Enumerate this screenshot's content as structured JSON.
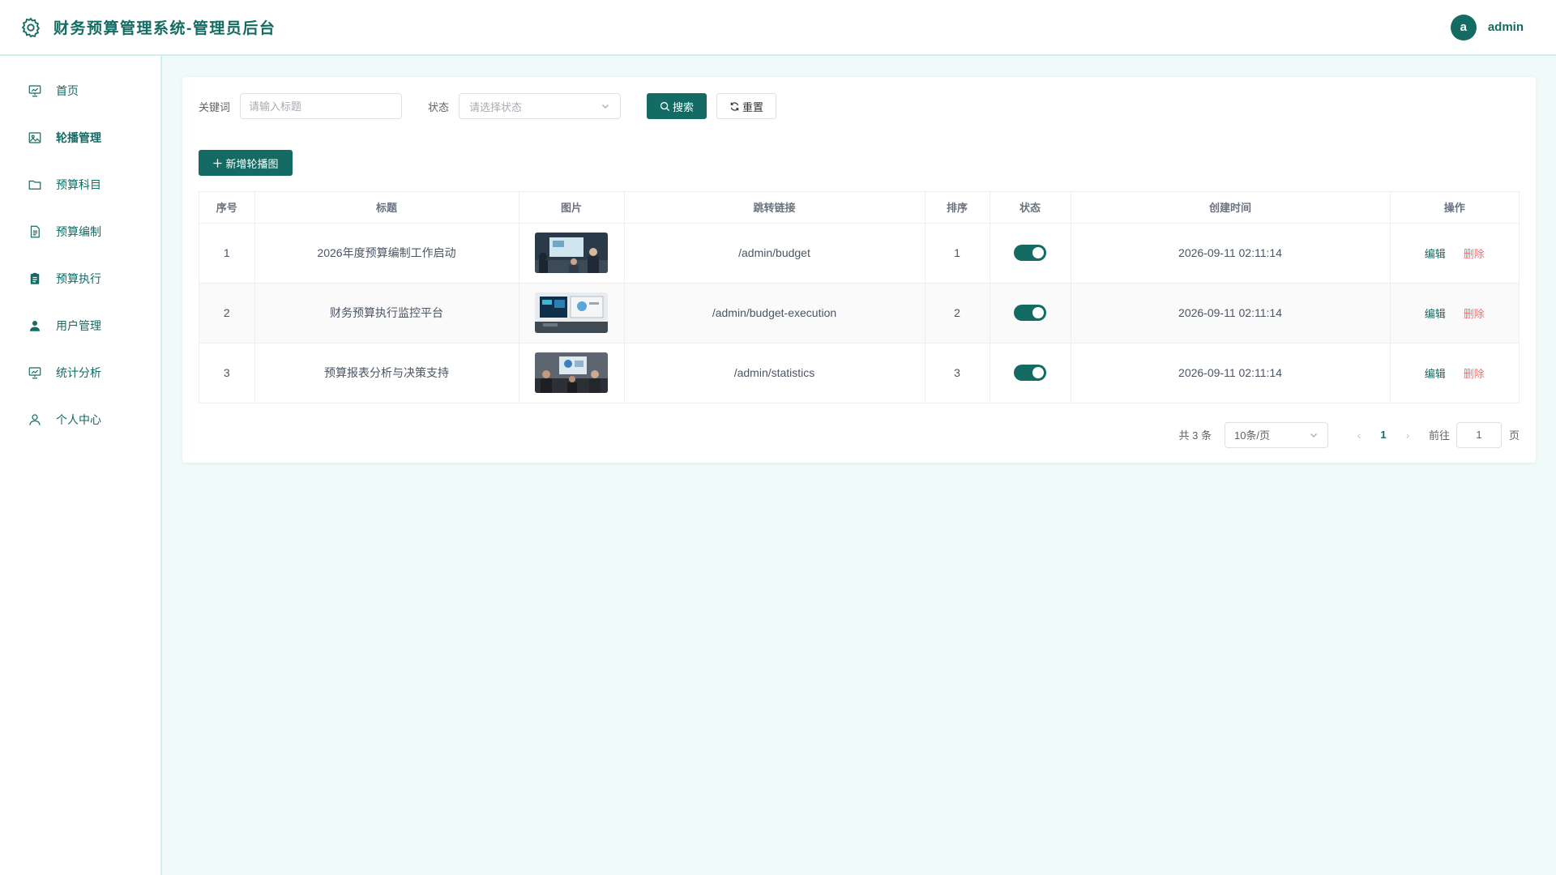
{
  "header": {
    "title": "财务预算管理系统-管理员后台",
    "avatar_letter": "a",
    "username": "admin"
  },
  "sidebar": {
    "items": [
      {
        "label": "首页",
        "icon": "dashboard-icon"
      },
      {
        "label": "轮播管理",
        "icon": "image-icon",
        "active": true
      },
      {
        "label": "预算科目",
        "icon": "folder-icon"
      },
      {
        "label": "预算编制",
        "icon": "document-icon"
      },
      {
        "label": "预算执行",
        "icon": "clipboard-icon"
      },
      {
        "label": "用户管理",
        "icon": "user-icon"
      },
      {
        "label": "统计分析",
        "icon": "chart-board-icon"
      },
      {
        "label": "个人中心",
        "icon": "user-outline-icon"
      }
    ]
  },
  "filters": {
    "keyword_label": "关键词",
    "keyword_placeholder": "请输入标题",
    "keyword_value": "",
    "status_label": "状态",
    "status_placeholder": "请选择状态",
    "search_label": "搜索",
    "reset_label": "重置"
  },
  "actions": {
    "add_label": "新增轮播图"
  },
  "table": {
    "columns": [
      "序号",
      "标题",
      "图片",
      "跳转链接",
      "排序",
      "状态",
      "创建时间",
      "操作"
    ],
    "rows": [
      {
        "index": "1",
        "title": "2026年度预算编制工作启动",
        "link": "/admin/budget",
        "sort": "1",
        "enabled": true,
        "created": "2026-09-11 02:11:14"
      },
      {
        "index": "2",
        "title": "财务预算执行监控平台",
        "link": "/admin/budget-execution",
        "sort": "2",
        "enabled": true,
        "created": "2026-09-11 02:11:14"
      },
      {
        "index": "3",
        "title": "预算报表分析与决策支持",
        "link": "/admin/statistics",
        "sort": "3",
        "enabled": true,
        "created": "2026-09-11 02:11:14"
      }
    ],
    "edit_label": "编辑",
    "delete_label": "删除"
  },
  "pagination": {
    "total_text": "共 3 条",
    "page_size": "10条/页",
    "current_page": "1",
    "goto_label": "前往",
    "goto_value": "1",
    "page_unit": "页"
  },
  "colors": {
    "primary": "#136b63",
    "danger": "#f56c6c",
    "background": "#f0fbf9"
  }
}
